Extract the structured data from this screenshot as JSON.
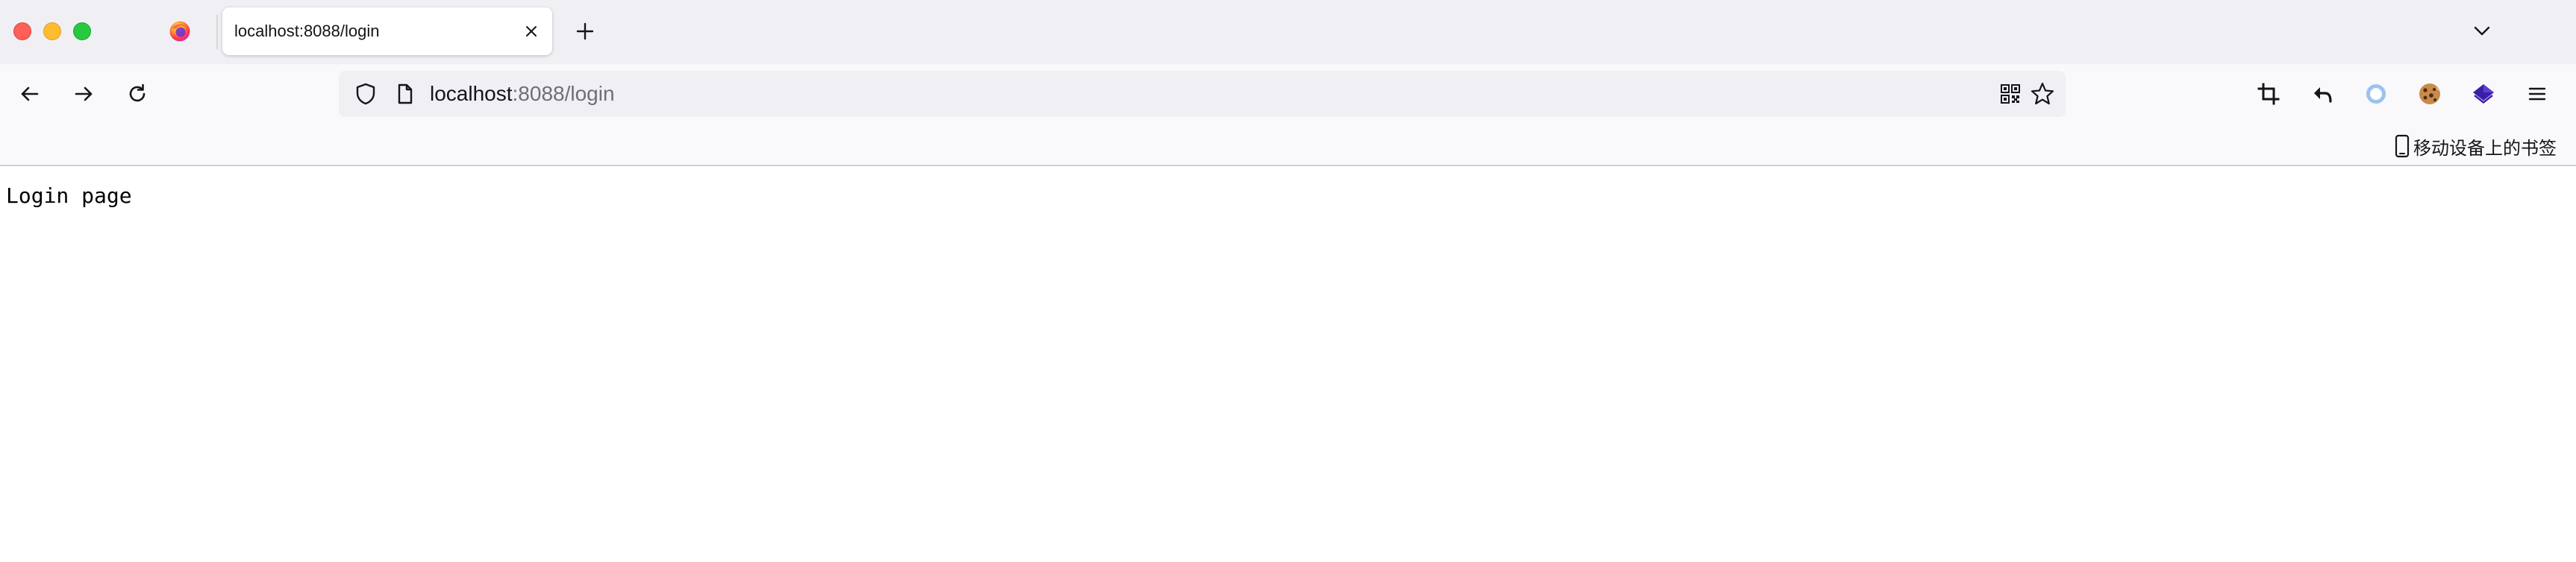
{
  "window": {
    "buttons": [
      "close",
      "minimize",
      "maximize"
    ]
  },
  "tabs": [
    {
      "title": "localhost:8088/login",
      "active": true
    }
  ],
  "toolbar": {
    "url_host": "localhost",
    "url_rest": ":8088/login",
    "icons_left": [
      "back-icon",
      "forward-icon",
      "reload-icon"
    ],
    "icons_right": [
      "crop-icon",
      "undo-icon",
      "circle-extension-icon",
      "cookie-icon",
      "layers-extension-icon",
      "menu-icon"
    ]
  },
  "bookmarks": {
    "mobile_label": "移动设备上的书签"
  },
  "page": {
    "text": "Login page"
  },
  "colors": {
    "tabstrip_bg": "#f0f0f4",
    "toolbar_bg": "#f9f9fb",
    "urlbar_bg": "#f0f0f4",
    "extension_blue": "#3b1fa8",
    "extension_ring": "#9cc3ee"
  }
}
